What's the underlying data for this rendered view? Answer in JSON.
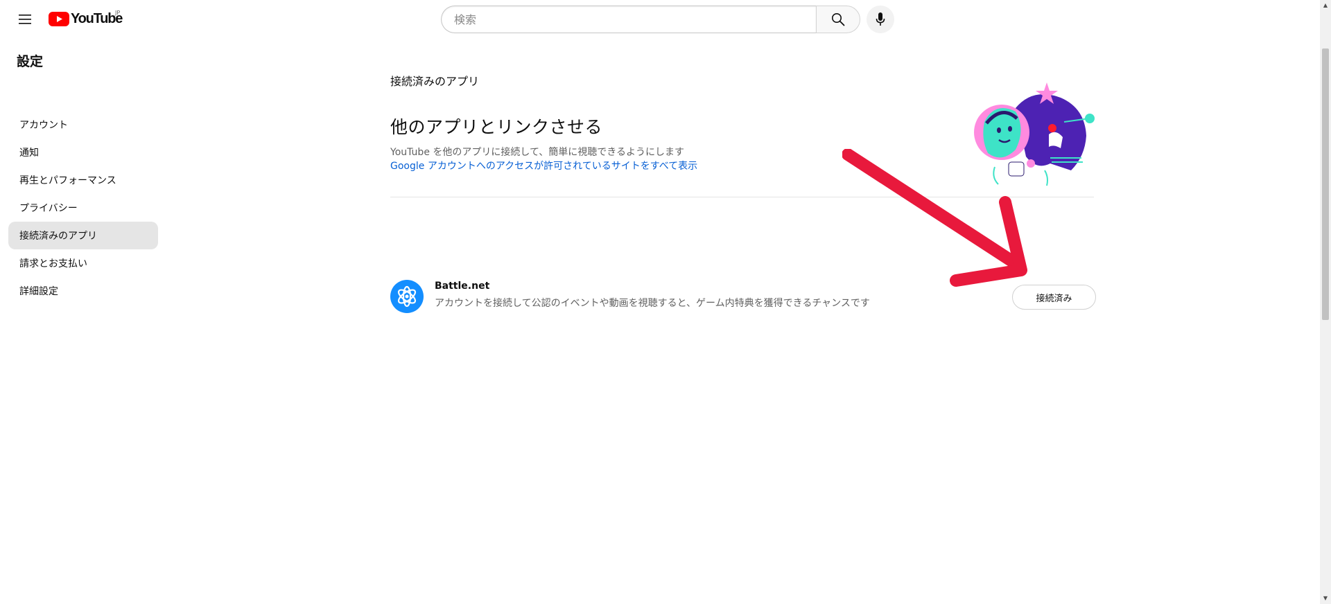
{
  "header": {
    "logo_text": "YouTube",
    "region": "JP",
    "search_placeholder": "検索"
  },
  "sidebar": {
    "title": "設定",
    "items": [
      {
        "label": "アカウント",
        "active": false
      },
      {
        "label": "通知",
        "active": false
      },
      {
        "label": "再生とパフォーマンス",
        "active": false
      },
      {
        "label": "プライバシー",
        "active": false
      },
      {
        "label": "接続済みのアプリ",
        "active": true
      },
      {
        "label": "請求とお支払い",
        "active": false
      },
      {
        "label": "詳細設定",
        "active": false
      }
    ]
  },
  "main": {
    "section_label": "接続済みのアプリ",
    "headline": "他のアプリとリンクさせる",
    "subtext": "YouTube を他のアプリに接続して、簡単に視聴できるようにします",
    "link_text": "Google アカウントへのアクセスが許可されているサイトをすべて表示",
    "apps": [
      {
        "name": "Battle.net",
        "description": "アカウントを接続して公認のイベントや動画を視聴すると、ゲーム内特典を獲得できるチャンスです",
        "button_label": "接続済み",
        "icon": "battlenet-icon"
      }
    ]
  },
  "colors": {
    "brand_red": "#ff0000",
    "link_blue": "#065fd4",
    "annotation_arrow": "#e8193c",
    "active_bg": "#e5e5e5"
  }
}
